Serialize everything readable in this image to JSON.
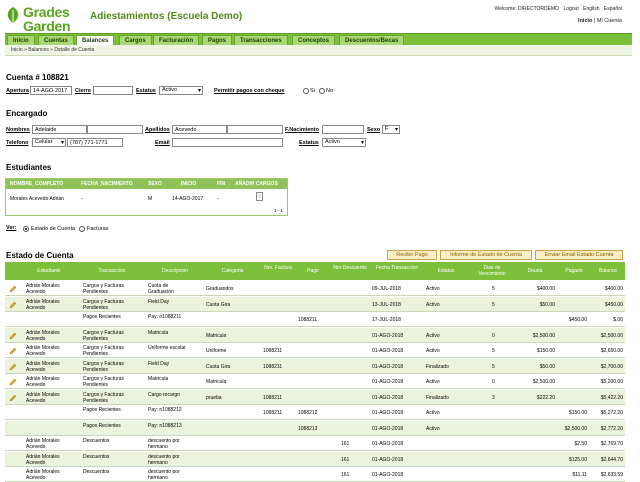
{
  "header": {
    "logo_line1": "Grades",
    "logo_line2": "Garden",
    "school": "Adiestamientos (Escuela Demo)",
    "welcome": "Welcome: DIRECTORDEMO",
    "logout": "Logout",
    "lang_en": "English",
    "lang_es": "Español",
    "link_inicio": "Inicio",
    "link_sep": "|",
    "link_mi_cuenta": "Mi Cuenta"
  },
  "nav": {
    "items": [
      "Inicio",
      "Cuentas",
      "Balances",
      "Cargos",
      "Facturación",
      "Pagos",
      "Transacciones",
      "Conceptos",
      "Descuentos/Becas"
    ],
    "active_index": 2
  },
  "breadcrumb": {
    "items": [
      "Inicio",
      "Balances",
      "Detalle de Cuenta"
    ],
    "sep": "»"
  },
  "cuenta": {
    "title": "Cuenta # 108821",
    "apertura_label": "Apertura",
    "apertura_value": "14-AGO-2017",
    "cierre_label": "Cierre",
    "cierre_value": "",
    "estatus_label": "Estatus",
    "estatus_value": "Activo",
    "permitir_label": "Permitir pagos con cheque",
    "si": "Si",
    "no": "No"
  },
  "encargado": {
    "title": "Encargado",
    "nombres_label": "Nombres",
    "nombres_value": "Adelaide",
    "apellidos_label": "Apellidos",
    "apellidos_value": "Acevedo",
    "nacimiento_label": "F.Nacimiento",
    "nacimiento_value": "",
    "sexo_label": "Sexo",
    "sexo_value": "F",
    "telefono_label": "Telefono",
    "telefono_type": "Celular",
    "telefono_value": "(787) 771-1771",
    "email_label": "Email",
    "email_value": "",
    "estatus_label": "Estatus",
    "estatus_value": "Activo"
  },
  "estudiantes": {
    "title": "Estudiantes",
    "columns": [
      "NOMBRE_COMPLETO",
      "FECHA_NACIMIENTO",
      "SEXO",
      "INICIO",
      "FIN",
      "AÑADIR CARGOS"
    ],
    "row": [
      "Morales Acevedo Adrián",
      "-",
      "M",
      "14-AGO-2017",
      "-"
    ],
    "pager": "1 - 1"
  },
  "ver": {
    "label": "Ver:",
    "opt1": "Estado de Cuenta",
    "opt2": "Facturas"
  },
  "estado": {
    "title": "Estado de Cuenta",
    "btn_recibir": "Recibir Pago",
    "btn_informe": "Informe de Estado de Cuenta",
    "btn_email": "Enviar Email Estado Cuenta",
    "columns": [
      "Estudiante",
      "Transaccion",
      "Descripcion",
      "Categoria",
      "Nro. Factura",
      "Pago",
      "Nro Descuento",
      "Fecha Transaccion",
      "Estatus",
      "Dias de Vencimiento",
      "Deuda",
      "Pagado",
      "Balance"
    ],
    "rows": [
      {
        "pencil": true,
        "est": [
          "Adrián Morales",
          "Acevedo"
        ],
        "trans": [
          "Cargos y Facturas",
          "Pendientes"
        ],
        "desc": [
          "Cuota de",
          "Graduación"
        ],
        "cat": "Graduandos",
        "fact": "",
        "pago": "",
        "desc_nro": "",
        "fecha": "09-JUL-2018",
        "estatus": "Activo",
        "dias": "5",
        "deuda": "$400.00",
        "pagado": "",
        "balance": "$400.00"
      },
      {
        "pencil": true,
        "est": [
          "Adrián Morales",
          "Acevedo"
        ],
        "trans": [
          "Cargos y Facturas",
          "Pendientes"
        ],
        "desc": [
          "Field Day",
          ""
        ],
        "cat": "Cuota Gira",
        "fact": "",
        "pago": "",
        "desc_nro": "",
        "fecha": "13-JUL-2018",
        "estatus": "Activo",
        "dias": "5",
        "deuda": "$50.00",
        "pagado": "",
        "balance": "$450.00"
      },
      {
        "pencil": false,
        "est": [
          "",
          ""
        ],
        "trans": [
          "Pagos Recientes",
          ""
        ],
        "desc": [
          "Pay: n1088211",
          ""
        ],
        "cat": "",
        "fact": "",
        "pago": "1088211",
        "desc_nro": "",
        "fecha": "17-JUL-2018",
        "estatus": "",
        "dias": "",
        "deuda": "",
        "pagado": "$450.00",
        "balance": "$.00"
      },
      {
        "pencil": true,
        "est": [
          "Adrián Morales",
          "Acevedo"
        ],
        "trans": [
          "Cargos y Facturas",
          "Pendientes"
        ],
        "desc": [
          "Matricula",
          ""
        ],
        "cat": "Matricula",
        "fact": "",
        "pago": "",
        "desc_nro": "",
        "fecha": "01-AGO-2018",
        "estatus": "Activo",
        "dias": "0",
        "deuda": "$2,500.00",
        "pagado": "",
        "balance": "$2,500.00"
      },
      {
        "pencil": true,
        "est": [
          "Adrián Morales",
          "Acevedo"
        ],
        "trans": [
          "Cargos y Facturas",
          "Pendientes"
        ],
        "desc": [
          "Uniforme escolar",
          ""
        ],
        "cat": "Uniforme",
        "fact": "1088211",
        "pago": "",
        "desc_nro": "",
        "fecha": "01-AGO-2018",
        "estatus": "Activo",
        "dias": "5",
        "deuda": "$150.00",
        "pagado": "",
        "balance": "$2,650.00"
      },
      {
        "pencil": true,
        "est": [
          "Adrián Morales",
          "Acevedo"
        ],
        "trans": [
          "Cargos y Facturas",
          "Pendientes"
        ],
        "desc": [
          "Field Day",
          ""
        ],
        "cat": "Cuota Gira",
        "fact": "1088211",
        "pago": "",
        "desc_nro": "",
        "fecha": "01-AGO-2018",
        "estatus": "Finalizado",
        "dias": "5",
        "deuda": "$50.00",
        "pagado": "",
        "balance": "$2,700.00"
      },
      {
        "pencil": true,
        "est": [
          "Adrián Morales",
          "Acevedo"
        ],
        "trans": [
          "Cargos y Facturas",
          "Pendientes"
        ],
        "desc": [
          "Matricula",
          ""
        ],
        "cat": "Matricula",
        "fact": "",
        "pago": "",
        "desc_nro": "",
        "fecha": "01-AGO-2018",
        "estatus": "Activo",
        "dias": "0",
        "deuda": "$2,500.00",
        "pagado": "",
        "balance": "$5,200.00"
      },
      {
        "pencil": true,
        "est": [
          "Adrián Morales",
          "Acevedo"
        ],
        "trans": [
          "Cargos y Facturas",
          "Pendientes"
        ],
        "desc": [
          "Cargo recargo",
          ""
        ],
        "cat": "prueba",
        "fact": "1088211",
        "pago": "",
        "desc_nro": "",
        "fecha": "01-AGO-2018",
        "estatus": "Finalizado",
        "dias": "3",
        "deuda": "$222.20",
        "pagado": "",
        "balance": "$5,422.20"
      },
      {
        "pencil": false,
        "est": [
          "",
          ""
        ],
        "trans": [
          "Pagos Recientes",
          ""
        ],
        "desc": [
          "Pay: n1088212",
          ""
        ],
        "cat": "",
        "fact": "1088211",
        "pago": "1088212",
        "desc_nro": "",
        "fecha": "01-AGO-2018",
        "estatus": "Activo",
        "dias": "",
        "deuda": "",
        "pagado": "$150.00",
        "balance": "$5,272.20"
      },
      {
        "pencil": false,
        "est": [
          "",
          ""
        ],
        "trans": [
          "Pagos Recientes",
          ""
        ],
        "desc": [
          "Pay: n1088213",
          ""
        ],
        "cat": "",
        "fact": "",
        "pago": "1088213",
        "desc_nro": "",
        "fecha": "01-AGO-2018",
        "estatus": "Activo",
        "dias": "",
        "deuda": "",
        "pagado": "$2,500.00",
        "balance": "$2,772.20"
      },
      {
        "pencil": false,
        "est": [
          "Adrián Morales",
          "Acevedo"
        ],
        "trans": [
          "Descuentos",
          ""
        ],
        "desc": [
          "descuento por",
          "hermano"
        ],
        "cat": "",
        "fact": "",
        "pago": "",
        "desc_nro": "161",
        "fecha": "01-AGO-2018",
        "estatus": "",
        "dias": "",
        "deuda": "",
        "pagado": "$2.50",
        "balance": "$2,769.70"
      },
      {
        "pencil": false,
        "est": [
          "Adrián Morales",
          "Acevedo"
        ],
        "trans": [
          "Descuentos",
          ""
        ],
        "desc": [
          "descuento por",
          "hermano"
        ],
        "cat": "",
        "fact": "",
        "pago": "",
        "desc_nro": "161",
        "fecha": "01-AGO-2018",
        "estatus": "",
        "dias": "",
        "deuda": "",
        "pagado": "$125.00",
        "balance": "$2,644.70"
      },
      {
        "pencil": false,
        "est": [
          "Adrián Morales",
          "Acevedo"
        ],
        "trans": [
          "Descuentos",
          ""
        ],
        "desc": [
          "descuento por",
          "hermano"
        ],
        "cat": "",
        "fact": "",
        "pago": "",
        "desc_nro": "161",
        "fecha": "01-AGO-2018",
        "estatus": "",
        "dias": "",
        "deuda": "",
        "pagado": "$11.11",
        "balance": "$2,633.59"
      }
    ]
  },
  "colors": {
    "brand_green": "#5aa41e",
    "nav_green": "#7cbf3a",
    "row_alt": "#eaf4dc"
  },
  "icons": [
    "leaf-logo-icon",
    "pencil-icon",
    "document-icon",
    "dropdown-arrow-icon"
  ]
}
